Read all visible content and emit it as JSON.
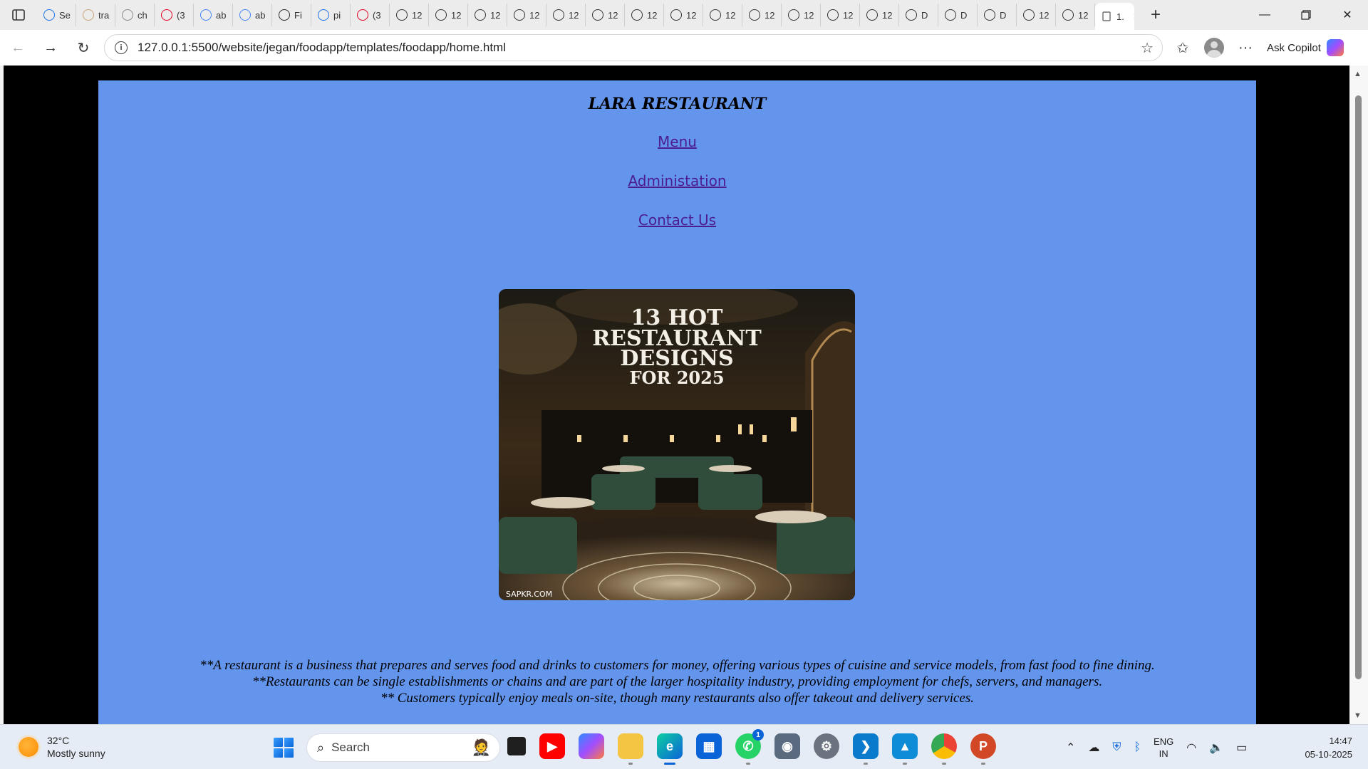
{
  "browser": {
    "tabs": [
      {
        "label": "Se",
        "icon": "search-icon",
        "color": "#1a73e8"
      },
      {
        "label": "tra",
        "icon": "image-icon",
        "color": "#c9a37a"
      },
      {
        "label": "ch",
        "icon": "globe-icon",
        "color": "#888888"
      },
      {
        "label": "(3",
        "icon": "pinterest-icon",
        "color": "#e60023"
      },
      {
        "label": "ab",
        "icon": "google-icon",
        "color": "#4285f4"
      },
      {
        "label": "ab",
        "icon": "google-icon",
        "color": "#4285f4"
      },
      {
        "label": "Fi",
        "icon": "github-icon",
        "color": "#24292e"
      },
      {
        "label": "pi",
        "icon": "search-icon",
        "color": "#1a73e8"
      },
      {
        "label": "(3",
        "icon": "pinterest-icon",
        "color": "#e60023"
      },
      {
        "label": "12",
        "icon": "globe-icon",
        "color": "#333333"
      },
      {
        "label": "12",
        "icon": "globe-icon",
        "color": "#333333"
      },
      {
        "label": "12",
        "icon": "globe-icon",
        "color": "#333333"
      },
      {
        "label": "12",
        "icon": "globe-icon",
        "color": "#333333"
      },
      {
        "label": "12",
        "icon": "globe-icon",
        "color": "#333333"
      },
      {
        "label": "12",
        "icon": "globe-icon",
        "color": "#333333"
      },
      {
        "label": "12",
        "icon": "globe-icon",
        "color": "#333333"
      },
      {
        "label": "12",
        "icon": "globe-icon",
        "color": "#333333"
      },
      {
        "label": "12",
        "icon": "globe-icon",
        "color": "#333333"
      },
      {
        "label": "12",
        "icon": "globe-icon",
        "color": "#333333"
      },
      {
        "label": "12",
        "icon": "globe-icon",
        "color": "#333333"
      },
      {
        "label": "12",
        "icon": "globe-icon",
        "color": "#333333"
      },
      {
        "label": "12",
        "icon": "globe-icon",
        "color": "#333333"
      },
      {
        "label": "D",
        "icon": "globe-icon",
        "color": "#333333"
      },
      {
        "label": "D",
        "icon": "globe-icon",
        "color": "#333333"
      },
      {
        "label": "D",
        "icon": "globe-icon",
        "color": "#333333"
      },
      {
        "label": "12",
        "icon": "globe-icon",
        "color": "#333333"
      },
      {
        "label": "12",
        "icon": "globe-icon",
        "color": "#333333"
      }
    ],
    "active_tab_label": "1.",
    "url": "127.0.0.1:5500/website/jegan/foodapp/templates/foodapp/home.html",
    "copilot_label": "Ask Copilot"
  },
  "page": {
    "title": "LARA RESTAURANT",
    "nav": [
      "Menu",
      "Administation",
      "Contact Us"
    ],
    "hero": {
      "lines": [
        "13 HOT",
        "RESTAURANT",
        "DESIGNS",
        "FOR 2025"
      ],
      "credit": "SAPKR.COM"
    },
    "caption": [
      "**A restaurant is a business that prepares and serves food and drinks to customers for money, offering various types of cuisine and service models, from fast food to fine dining.",
      "**Restaurants can be single establishments or chains and are part of the larger hospitality industry, providing employment for chefs, servers, and managers.",
      "** Customers typically enjoy meals on-site, though many restaurants also offer takeout and delivery services."
    ],
    "background_color": "#6495ed"
  },
  "taskbar": {
    "weather": {
      "temp": "32°C",
      "condition": "Mostly sunny"
    },
    "search_label": "Search",
    "whatsapp_badge": "1",
    "lang": {
      "line1": "ENG",
      "line2": "IN"
    },
    "time": "14:47",
    "date": "05-10-2025"
  }
}
